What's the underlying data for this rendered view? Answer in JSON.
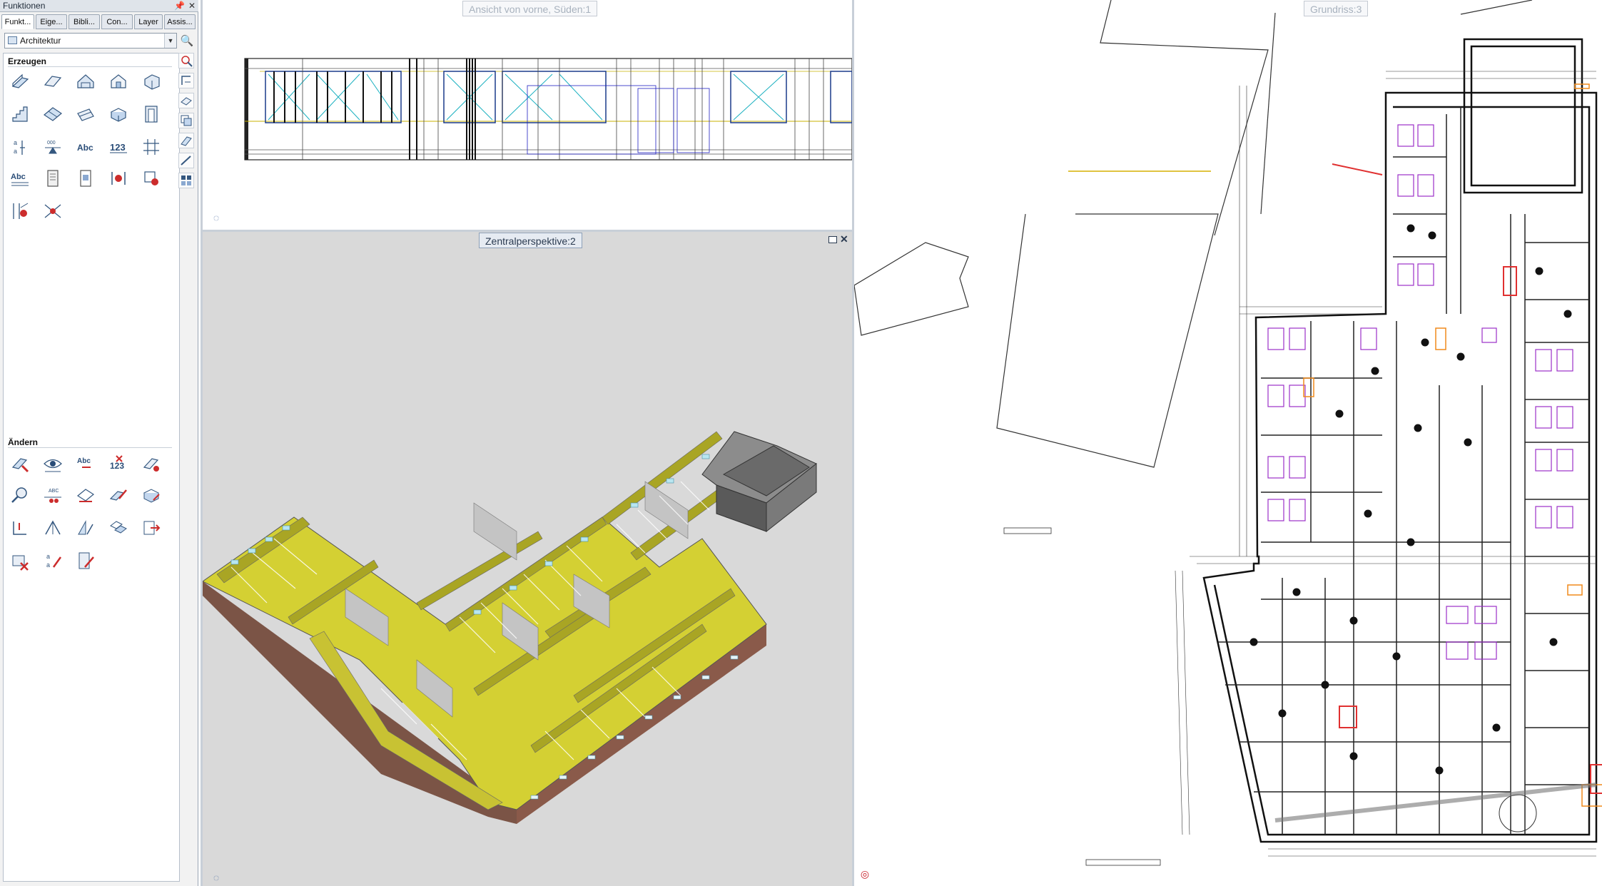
{
  "panel": {
    "title": "Funktionen",
    "pin_icon": "pin-icon",
    "close_icon": "close-icon",
    "tabs": [
      {
        "label": "Funkt...",
        "active": true
      },
      {
        "label": "Eige..."
      },
      {
        "label": "Bibli..."
      },
      {
        "label": "Con..."
      },
      {
        "label": "Layer"
      },
      {
        "label": "Assis..."
      }
    ],
    "module_select": {
      "value": "Architektur"
    },
    "sections": {
      "create": "Erzeugen",
      "modify": "Ändern"
    },
    "tool_texts": {
      "abc": "Abc",
      "num": "123",
      "abc_small": "Abc",
      "a_label": "a",
      "abc_caps": "ABC",
      "dots": "000"
    }
  },
  "viewports": {
    "front": {
      "label": "Ansicht von vorne, Süden:1"
    },
    "perspective": {
      "label": "Zentralperspektive:2"
    },
    "plan": {
      "label": "Grundriss:3"
    }
  },
  "colors": {
    "model_floor": "#d4d033",
    "model_wall_outer": "#8a5a4a",
    "plan_furniture": "#9b30c8",
    "plan_highlight": "#e03030",
    "plan_accent": "#f08a1c",
    "perspective_bg": "#d9d9d9"
  }
}
